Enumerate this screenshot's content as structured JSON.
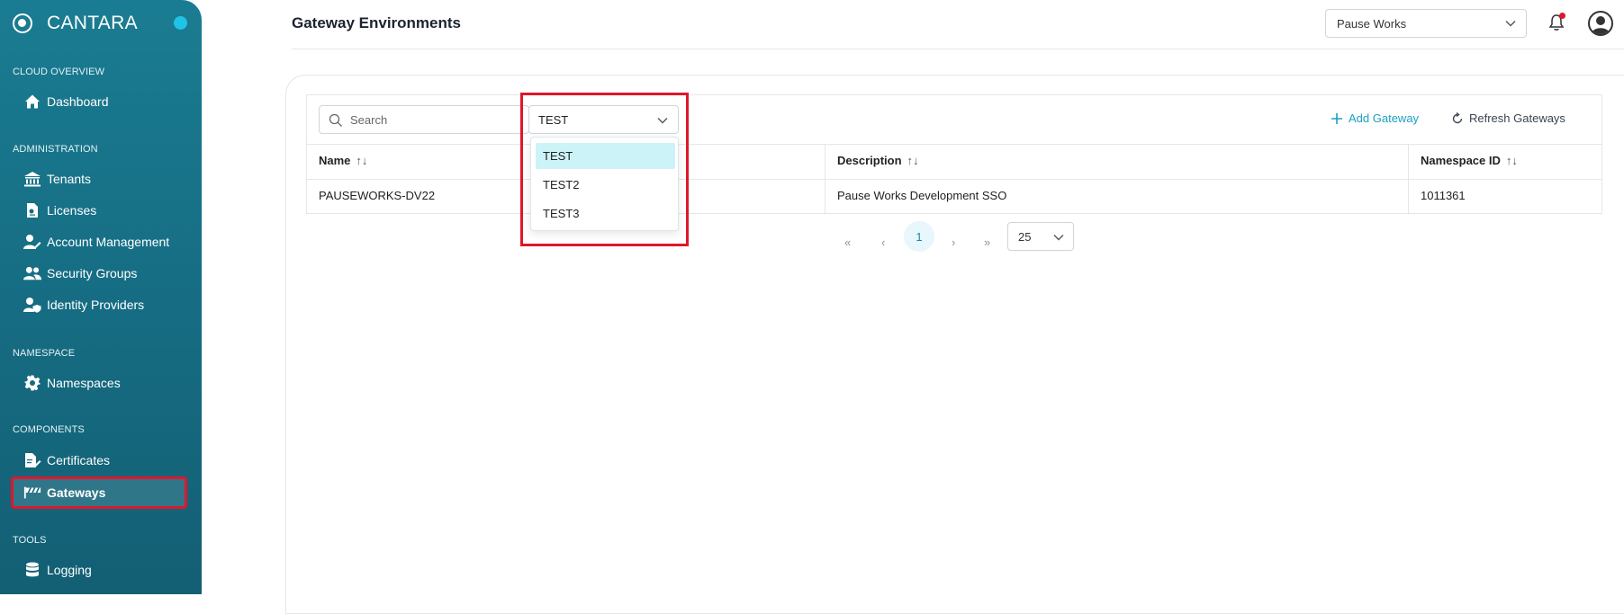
{
  "brand": {
    "name": "CANTARA"
  },
  "sidebar": {
    "sections": [
      {
        "title": "CLOUD OVERVIEW"
      },
      {
        "title": "ADMINISTRATION"
      },
      {
        "title": "NAMESPACE"
      },
      {
        "title": "COMPONENTS"
      },
      {
        "title": "TOOLS"
      }
    ],
    "items": [
      {
        "label": "Dashboard",
        "icon": "home-icon"
      },
      {
        "label": "Tenants",
        "icon": "bank-icon"
      },
      {
        "label": "Licenses",
        "icon": "license-icon"
      },
      {
        "label": "Account Management",
        "icon": "user-edit-icon"
      },
      {
        "label": "Security Groups",
        "icon": "users-icon"
      },
      {
        "label": "Identity Providers",
        "icon": "user-shield-icon"
      },
      {
        "label": "Namespaces",
        "icon": "gear-icon"
      },
      {
        "label": "Certificates",
        "icon": "certificate-icon"
      },
      {
        "label": "Gateways",
        "icon": "gateway-icon",
        "active": true
      },
      {
        "label": "Logging",
        "icon": "database-icon"
      }
    ]
  },
  "header": {
    "title": "Gateway Environments",
    "org_select": "Pause Works"
  },
  "toolbar": {
    "search_placeholder": "Search",
    "environment_select": "TEST",
    "add_label": "Add Gateway",
    "refresh_label": "Refresh Gateways"
  },
  "table": {
    "columns": [
      "Name",
      "Description",
      "Namespace ID"
    ],
    "sort_glyph": "↑↓",
    "rows": [
      {
        "name": "PAUSEWORKS-DV22",
        "description": "Pause Works Development SSO",
        "namespace_id": "1011361"
      }
    ]
  },
  "pagination": {
    "current_page": "1",
    "per_page": "25",
    "first": "«",
    "prev": "‹",
    "next": "›",
    "last": "»"
  },
  "dropdown": {
    "options": [
      "TEST",
      "TEST2",
      "TEST3"
    ],
    "selected": "TEST"
  },
  "colors": {
    "sidebar": "#166d83",
    "accent": "#1aa2c2",
    "highlight": "#e0162b",
    "notification": "#e0162b"
  }
}
